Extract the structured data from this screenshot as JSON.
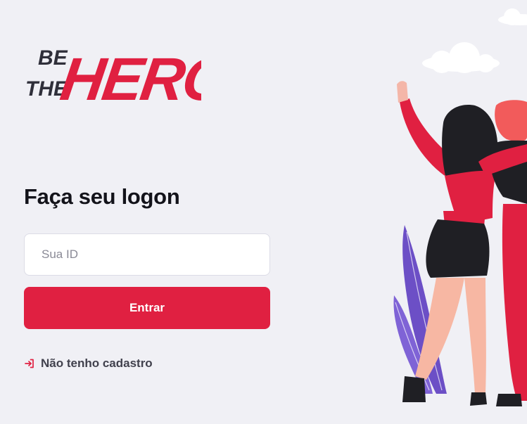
{
  "logo": {
    "line1": "BE",
    "line2": "THE",
    "word": "HERO"
  },
  "form": {
    "title": "Faça seu logon",
    "id_placeholder": "Sua ID",
    "submit_label": "Entrar"
  },
  "register_link": {
    "label": "Não tenho cadastro",
    "icon": "log-in-icon"
  },
  "illustration": {
    "name": "heroes-illustration"
  },
  "colors": {
    "background": "#f0f0f5",
    "accent": "#e02041",
    "text_dark": "#13131a",
    "text_muted": "#41414d"
  }
}
